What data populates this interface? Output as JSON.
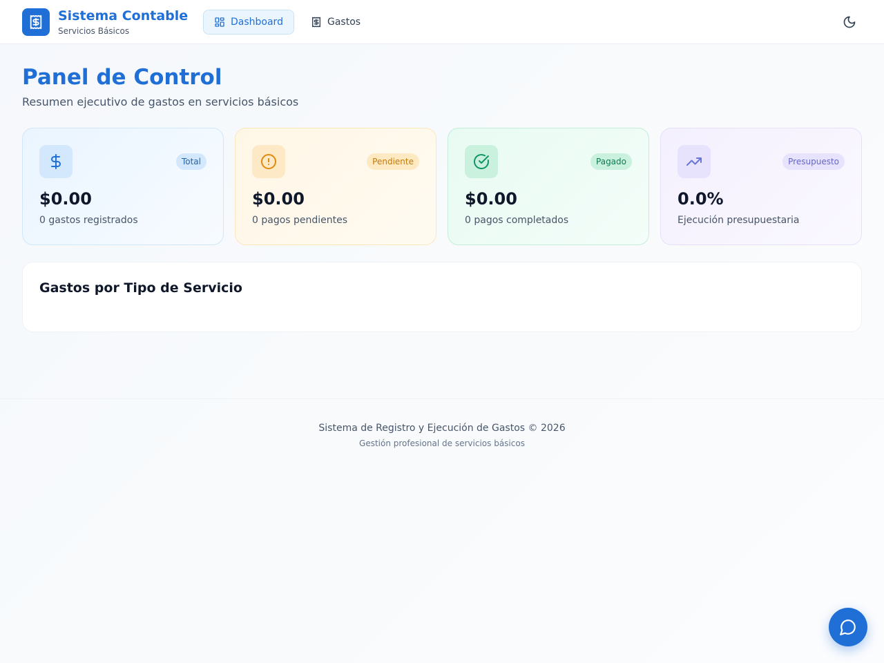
{
  "header": {
    "brand_title": "Sistema Contable",
    "brand_subtitle": "Servicios Básicos",
    "logo_icon": "receipt-dollar-icon",
    "nav": [
      {
        "label": "Dashboard",
        "icon": "layout-grid-icon",
        "active": true
      },
      {
        "label": "Gastos",
        "icon": "receipt-icon",
        "active": false
      }
    ],
    "theme_toggle_icon": "moon-icon"
  },
  "page": {
    "title": "Panel de Control",
    "subtitle": "Resumen ejecutivo de gastos en servicios básicos"
  },
  "stats": [
    {
      "badge": "Total",
      "value": "$0.00",
      "description": "0 gastos registrados",
      "icon": "dollar-icon",
      "accent": "#1f6fd6"
    },
    {
      "badge": "Pendiente",
      "value": "$0.00",
      "description": "0 pagos pendientes",
      "icon": "alert-circle-icon",
      "accent": "#e08a0b"
    },
    {
      "badge": "Pagado",
      "value": "$0.00",
      "description": "0 pagos completados",
      "icon": "check-circle-icon",
      "accent": "#10946a"
    },
    {
      "badge": "Presupuesto",
      "value": "0.0%",
      "description": "Ejecución presupuestaria",
      "icon": "trending-up-icon",
      "accent": "#6a74d6"
    }
  ],
  "services_panel": {
    "title": "Gastos por Tipo de Servicio"
  },
  "footer": {
    "main": "Sistema de Registro y Ejecución de Gastos © 2026",
    "sub": "Gestión profesional de servicios básicos"
  },
  "chat_button": {
    "icon": "chat-bubble-icon"
  },
  "colors": {
    "primary": "#1f6fd6",
    "text_dark": "#0f172a",
    "text_muted": "#475569"
  }
}
